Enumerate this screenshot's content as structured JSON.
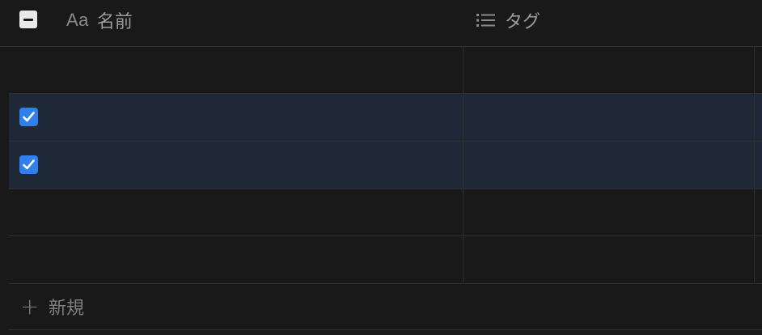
{
  "table": {
    "columns": [
      {
        "icon": "text-type-icon",
        "icon_text": "Aa",
        "label": "名前"
      },
      {
        "icon": "list-icon",
        "label": "タグ"
      }
    ],
    "header_checkbox_state": "indeterminate",
    "rows": [
      {
        "selected": false,
        "name": "",
        "tags": ""
      },
      {
        "selected": true,
        "name": "",
        "tags": ""
      },
      {
        "selected": true,
        "name": "",
        "tags": ""
      },
      {
        "selected": false,
        "name": "",
        "tags": ""
      },
      {
        "selected": false,
        "name": "",
        "tags": ""
      }
    ],
    "new_row": {
      "icon": "plus-icon",
      "label": "新規"
    }
  },
  "colors": {
    "background": "#191919",
    "selected_row": "#1f2836",
    "checkbox_accent": "#2f80ed",
    "border": "#2f2f2f"
  }
}
